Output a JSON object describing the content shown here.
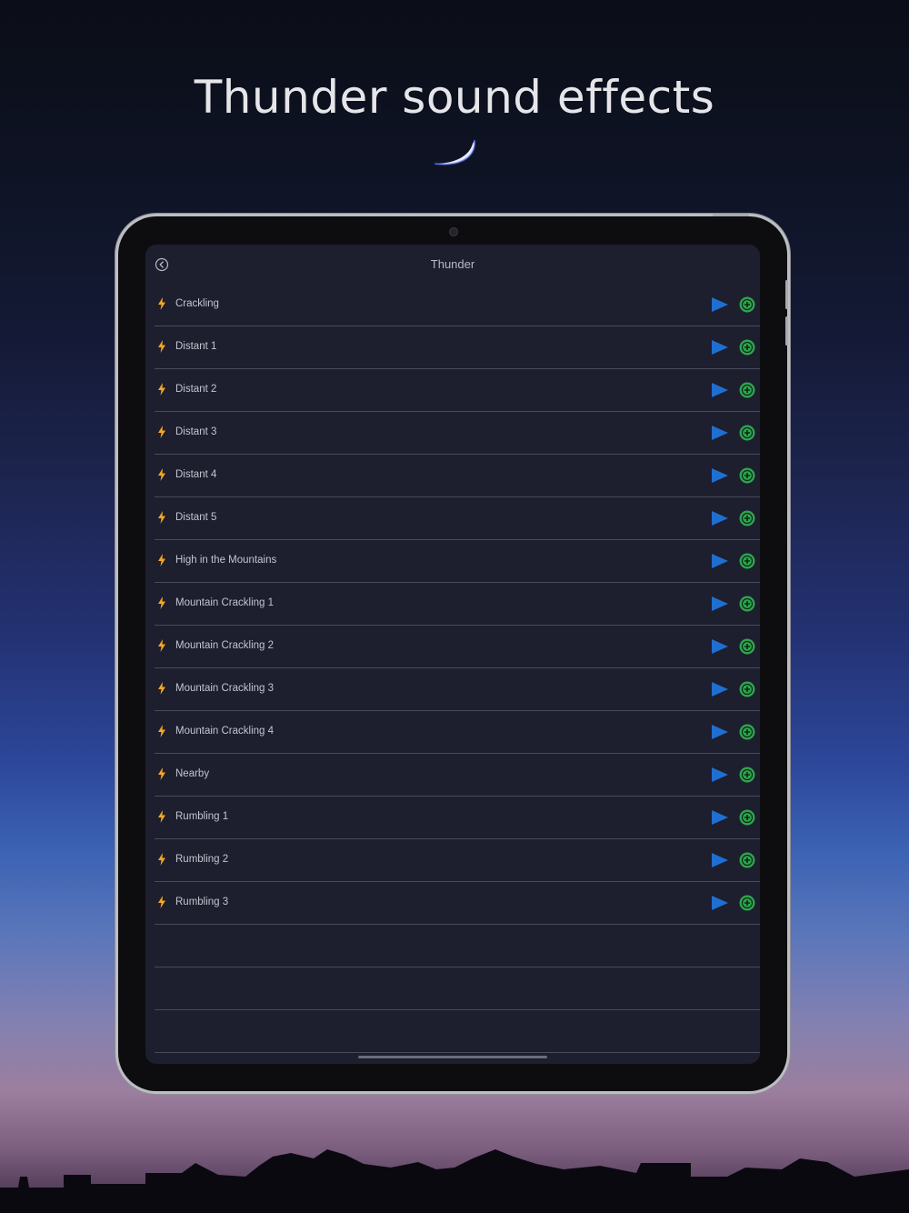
{
  "headline": "Thunder sound effects",
  "screen": {
    "title": "Thunder",
    "back_icon": "chevron-left-circle-icon",
    "colors": {
      "bolt": "#f5a623",
      "play": "#1f6fd1",
      "add_bg": "#2ea44f",
      "background": "#1d1e2e"
    },
    "sounds": [
      {
        "label": "Crackling"
      },
      {
        "label": "Distant 1"
      },
      {
        "label": "Distant 2"
      },
      {
        "label": "Distant 3"
      },
      {
        "label": "Distant 4"
      },
      {
        "label": "Distant 5"
      },
      {
        "label": "High in the Mountains"
      },
      {
        "label": "Mountain Crackling 1"
      },
      {
        "label": "Mountain Crackling 2"
      },
      {
        "label": "Mountain Crackling 3"
      },
      {
        "label": "Mountain Crackling 4"
      },
      {
        "label": "Nearby"
      },
      {
        "label": "Rumbling 1"
      },
      {
        "label": "Rumbling 2"
      },
      {
        "label": "Rumbling 3"
      }
    ]
  }
}
